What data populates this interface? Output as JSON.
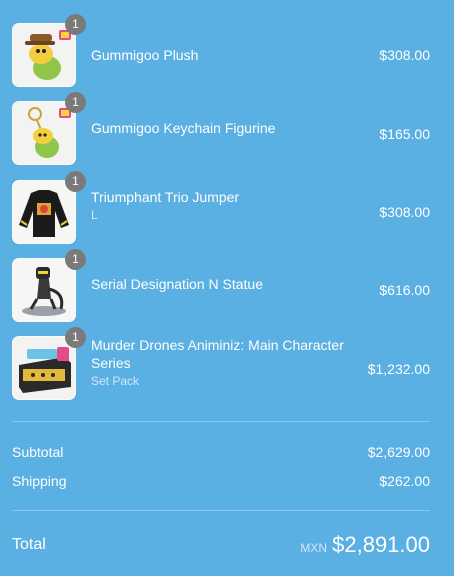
{
  "items": [
    {
      "title": "Gummigoo Plush",
      "variant": "",
      "price": "$308.00",
      "quantity": "1",
      "image_icon": "gummigoo-plush-icon"
    },
    {
      "title": "Gummigoo Keychain Figurine",
      "variant": "",
      "price": "$165.00",
      "quantity": "1",
      "image_icon": "gummigoo-keychain-icon"
    },
    {
      "title": "Triumphant Trio Jumper",
      "variant": "L",
      "price": "$308.00",
      "quantity": "1",
      "image_icon": "jumper-icon"
    },
    {
      "title": "Serial Designation N Statue",
      "variant": "",
      "price": "$616.00",
      "quantity": "1",
      "image_icon": "statue-icon"
    },
    {
      "title": "Murder Drones Animiniz: Main Character Series",
      "variant": "Set Pack",
      "price": "$1,232.00",
      "quantity": "1",
      "image_icon": "animiniz-box-icon"
    }
  ],
  "subtotal": {
    "label": "Subtotal",
    "value": "$2,629.00"
  },
  "shipping": {
    "label": "Shipping",
    "value": "$262.00"
  },
  "total": {
    "label": "Total",
    "currency": "MXN",
    "value": "$2,891.00"
  },
  "colors": {
    "background": "#5aafe3",
    "badge": "#7a7a7a",
    "text": "#ffffff"
  }
}
